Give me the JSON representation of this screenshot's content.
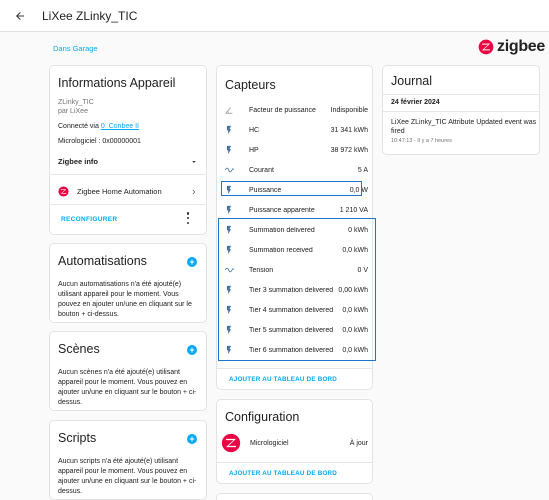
{
  "header": {
    "title": "LiXee ZLinky_TIC"
  },
  "area_link": "Dans Garage",
  "zigbee_logo": {
    "text": "zigbee",
    "color": "#eb0443"
  },
  "device_info": {
    "title": "Informations Appareil",
    "model": "ZLinky_TIC",
    "manufacturer": "par LiXee",
    "connected_prefix": "Connecté via",
    "connected_link": "0_Conbee II",
    "firmware": "Micrologiciel : 0x00000001",
    "zigbee_info": "Zigbee info",
    "integration": "Zigbee Home Automation",
    "reconfigure": "RECONFIGURER"
  },
  "automations": {
    "title": "Automatisations",
    "text": "Aucun automatisations n'a été ajouté(e) utilisant appareil pour le moment. Vous pouvez en ajouter un/une en cliquant sur le bouton + ci-dessus."
  },
  "scenes": {
    "title": "Scènes",
    "text": "Aucun scènes n'a été ajouté(e) utilisant appareil pour le moment. Vous pouvez en ajouter un/une en cliquant sur le bouton + ci-dessus."
  },
  "scripts": {
    "title": "Scripts",
    "text": "Aucun scripts n'a été ajouté(e) utilisant appareil pour le moment. Vous pouvez en ajouter un/une en cliquant sur le bouton + ci-dessus."
  },
  "sensors": {
    "title": "Capteurs",
    "rows": [
      {
        "icon": "angle-icon",
        "name": "Facteur de puissance",
        "value": "Indisponible"
      },
      {
        "icon": "flash-icon",
        "name": "HC",
        "value": "31 341 kWh"
      },
      {
        "icon": "flash-icon",
        "name": "HP",
        "value": "38 972 kWh"
      },
      {
        "icon": "sine-wave-icon",
        "name": "Courant",
        "value": "5 A"
      },
      {
        "icon": "flash-icon",
        "name": "Puissance",
        "value": "0,0 W"
      },
      {
        "icon": "flash-icon",
        "name": "Puissance apparente",
        "value": "1 210 VA"
      },
      {
        "icon": "flash-icon",
        "name": "Summation delivered",
        "value": "0 kWh"
      },
      {
        "icon": "flash-icon",
        "name": "Summation received",
        "value": "0,0 kWh"
      },
      {
        "icon": "sine-wave-icon",
        "name": "Tension",
        "value": "0 V"
      },
      {
        "icon": "flash-icon",
        "name": "Tier 3 summation delivered",
        "value": "0,00 kWh"
      },
      {
        "icon": "flash-icon",
        "name": "Tier 4 summation delivered",
        "value": "0,0 kWh"
      },
      {
        "icon": "flash-icon",
        "name": "Tier 5 summation delivered",
        "value": "0,0 kWh"
      },
      {
        "icon": "flash-icon",
        "name": "Tier 6 summation delivered",
        "value": "0,0 kWh"
      }
    ],
    "add_to_dashboard": "AJOUTER AU TABLEAU DE BORD"
  },
  "configuration": {
    "title": "Configuration",
    "row_name": "Micrologiciel",
    "row_value": "À jour",
    "add_to_dashboard": "AJOUTER AU TABLEAU DE BORD"
  },
  "journal": {
    "title": "Journal",
    "date": "24 février 2024",
    "message": "LiXee ZLinky_TIC Attribute Updated event was fired",
    "time": "10:47:13 - Il y a 7 heures"
  },
  "colors": {
    "accent": "#03a9f4",
    "highlight": "#1976d2",
    "zigbee_red": "#eb0443",
    "icon_blue": "#44739e"
  }
}
